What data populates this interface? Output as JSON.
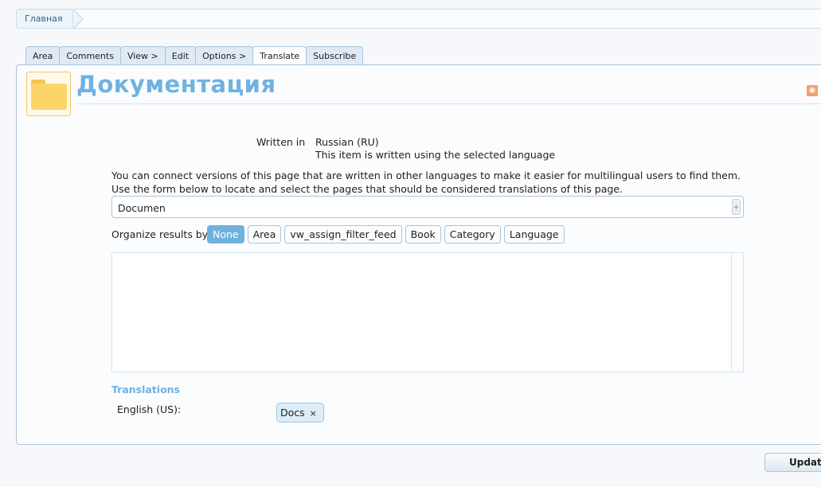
{
  "breadcrumb": {
    "home": "Главная"
  },
  "tabs": [
    {
      "label": "Area"
    },
    {
      "label": "Comments"
    },
    {
      "label": "View >"
    },
    {
      "label": "Edit"
    },
    {
      "label": "Options >"
    },
    {
      "label": "Translate",
      "active": true
    },
    {
      "label": "Subscribe"
    }
  ],
  "page": {
    "title": "Документация",
    "icon": "folder-icon",
    "feed_icon": "rss-icon"
  },
  "language": {
    "written_in_label": "Written in",
    "value": "Russian (RU)",
    "note": "This item is written using the selected language"
  },
  "description": "You can connect versions of this page that are written in other languages to make it easier for multilingual users to find them. Use the form below to locate and select the pages that should be considered translations of this page.",
  "search": {
    "value": "Documen"
  },
  "organize": {
    "label": "Organize results by:",
    "options": [
      "None",
      "Area",
      "vw_assign_filter_feed",
      "Book",
      "Category",
      "Language"
    ],
    "selected": "None"
  },
  "translations": {
    "title": "Translations",
    "items": [
      {
        "language": "English (US):",
        "page": "Docs",
        "remove": "×"
      }
    ]
  },
  "actions": {
    "update": "Update"
  },
  "colors": {
    "accent": "#6fb2e0",
    "border": "#a9c4db",
    "chip": "#dcecf8"
  }
}
